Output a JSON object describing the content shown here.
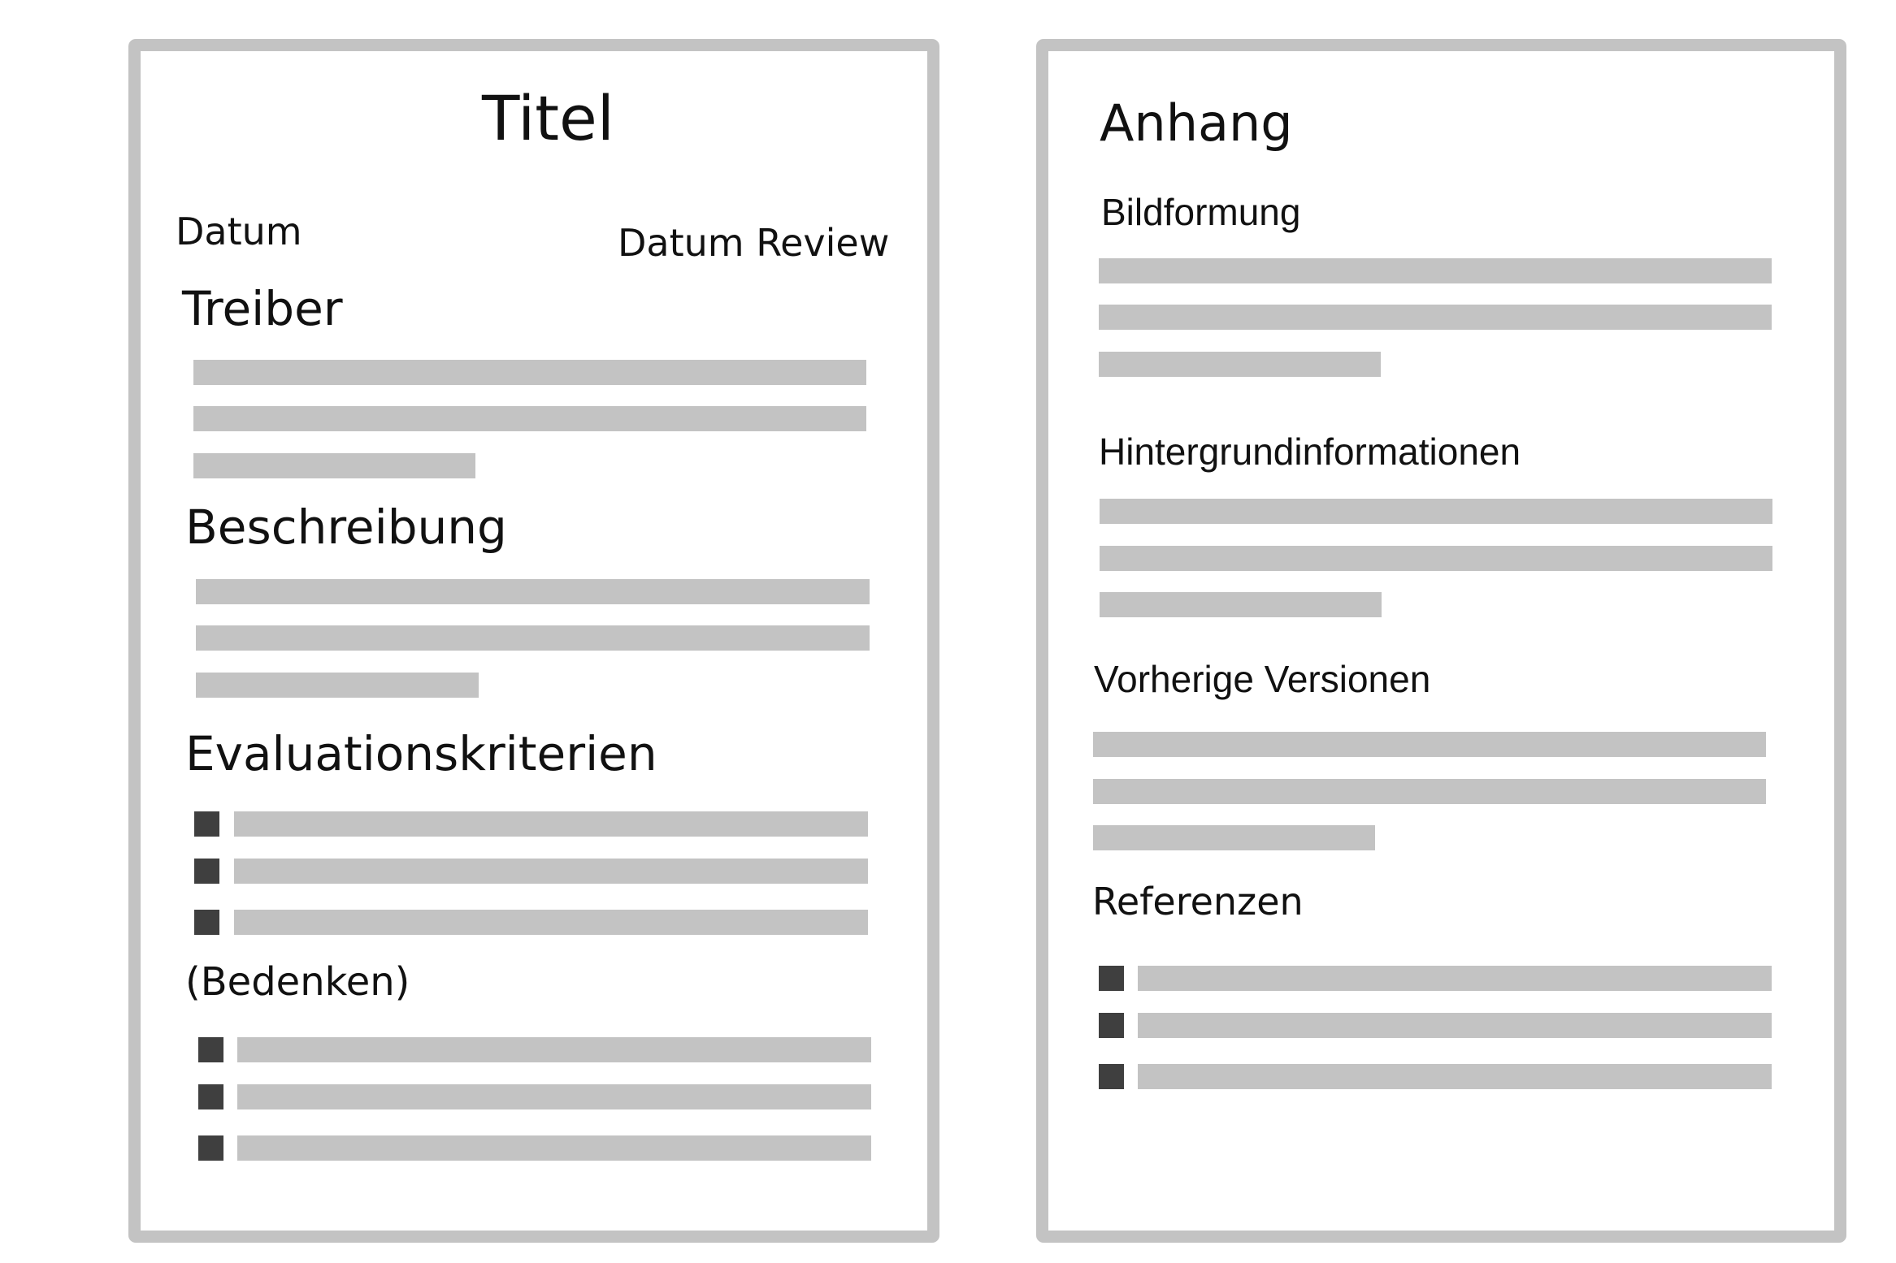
{
  "left_page": {
    "title": "Titel",
    "date_label": "Datum",
    "review_date_label": "Datum Review",
    "sections": {
      "drivers": "Treiber",
      "description": "Beschreibung",
      "criteria": "Evaluationskriterien",
      "concerns": "(Bedenken)"
    }
  },
  "right_page": {
    "title": "Anhang",
    "sections": {
      "image_formation": "Bildformung",
      "background": "Hintergrundinformationen",
      "previous_versions": "Vorherige Versionen",
      "references": "Referenzen"
    }
  },
  "colors": {
    "frame": "#c3c3c3",
    "placeholder_line": "#c3c3c3",
    "bullet": "#3f3f3f",
    "text": "#111111"
  }
}
